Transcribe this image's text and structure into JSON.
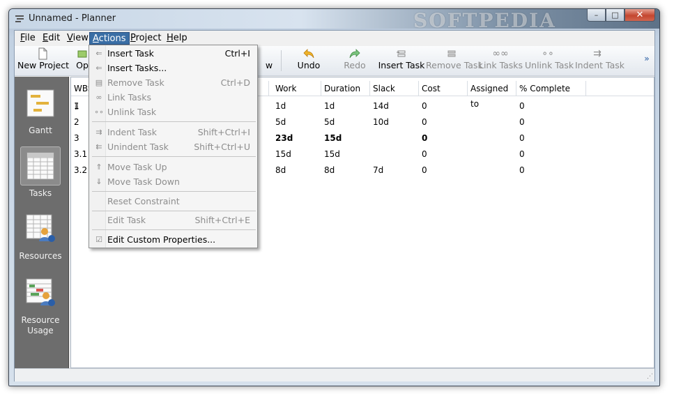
{
  "window": {
    "title": "Unnamed - Planner",
    "watermark": "SOFTPEDIA",
    "controls": {
      "minimize": "–",
      "maximize": "□",
      "close": "✕"
    }
  },
  "menubar": {
    "items": [
      "File",
      "Edit",
      "View",
      "Actions",
      "Project",
      "Help"
    ],
    "active": "Actions"
  },
  "toolbar": {
    "buttons": [
      {
        "label": "New Project",
        "icon": "page-icon",
        "enabled": true
      },
      {
        "label": "Op",
        "icon": "open-icon",
        "enabled": true
      },
      {
        "label": "w",
        "icon": "view-icon",
        "enabled": true
      },
      {
        "label": "Undo",
        "icon": "undo-arrow-icon",
        "enabled": true
      },
      {
        "label": "Redo",
        "icon": "redo-arrow-icon",
        "enabled": false
      },
      {
        "label": "Insert Task",
        "icon": "insert-task-icon",
        "enabled": true
      },
      {
        "label": "Remove Task",
        "icon": "remove-task-icon",
        "enabled": false
      },
      {
        "label": "Link Tasks",
        "icon": "link-tasks-icon",
        "enabled": false
      },
      {
        "label": "Unlink Task",
        "icon": "unlink-task-icon",
        "enabled": false
      },
      {
        "label": "Indent Task",
        "icon": "indent-task-icon",
        "enabled": false
      }
    ],
    "overflow": "»"
  },
  "sidebar": {
    "items": [
      {
        "label": "Gantt",
        "icon": "gantt-icon",
        "active": false
      },
      {
        "label": "Tasks",
        "icon": "tasks-icon",
        "active": true
      },
      {
        "label": "Resources",
        "icon": "resources-icon",
        "active": false
      },
      {
        "label": "Resource Usage",
        "icon": "resource-usage-icon",
        "active": false
      }
    ]
  },
  "table": {
    "columns": [
      "WBS",
      "Work",
      "Duration",
      "Slack",
      "Cost",
      "Assigned to",
      "% Complete"
    ],
    "rows": [
      {
        "wbs": "1",
        "work": "1d",
        "duration": "1d",
        "slack": "14d",
        "cost": "0",
        "assigned": "",
        "complete": "0",
        "bold": false
      },
      {
        "wbs": "2",
        "work": "5d",
        "duration": "5d",
        "slack": "10d",
        "cost": "0",
        "assigned": "",
        "complete": "0",
        "bold": false
      },
      {
        "wbs": "3",
        "work": "23d",
        "duration": "15d",
        "slack": "",
        "cost": "0",
        "assigned": "",
        "complete": "0",
        "bold": true
      },
      {
        "wbs": "3.1",
        "work": "15d",
        "duration": "15d",
        "slack": "",
        "cost": "0",
        "assigned": "",
        "complete": "0",
        "bold": false
      },
      {
        "wbs": "3.2",
        "work": "8d",
        "duration": "8d",
        "slack": "7d",
        "cost": "0",
        "assigned": "",
        "complete": "0",
        "bold": false
      }
    ]
  },
  "actions_menu": {
    "items": [
      {
        "label": "Insert Task",
        "shortcut": "Ctrl+I",
        "enabled": true,
        "icon": "insert-task-icon"
      },
      {
        "label": "Insert Tasks...",
        "shortcut": "",
        "enabled": true,
        "icon": "insert-tasks-icon"
      },
      {
        "label": "Remove Task",
        "shortcut": "Ctrl+D",
        "enabled": false,
        "icon": "remove-task-icon"
      },
      {
        "label": "Link Tasks",
        "shortcut": "",
        "enabled": false,
        "icon": "link-tasks-icon"
      },
      {
        "label": "Unlink Task",
        "shortcut": "",
        "enabled": false,
        "icon": "unlink-task-icon"
      },
      {
        "label": "Indent Task",
        "shortcut": "Shift+Ctrl+I",
        "enabled": false,
        "icon": "indent-task-icon"
      },
      {
        "label": "Unindent Task",
        "shortcut": "Shift+Ctrl+U",
        "enabled": false,
        "icon": "unindent-task-icon"
      },
      {
        "label": "Move Task Up",
        "shortcut": "",
        "enabled": false,
        "icon": "move-up-icon"
      },
      {
        "label": "Move Task Down",
        "shortcut": "",
        "enabled": false,
        "icon": "move-down-icon"
      },
      {
        "label": "Reset Constraint",
        "shortcut": "",
        "enabled": false,
        "icon": ""
      },
      {
        "label": "Edit Task",
        "shortcut": "Shift+Ctrl+E",
        "enabled": false,
        "icon": ""
      },
      {
        "label": "Edit Custom Properties...",
        "shortcut": "",
        "enabled": true,
        "icon": "properties-icon"
      }
    ]
  },
  "colors": {
    "menu_highlight": "#3a6ea5",
    "sidebar_bg": "#6d6d6d",
    "undo_arrow": "#e0a21a",
    "redo_arrow": "#4caf50"
  }
}
